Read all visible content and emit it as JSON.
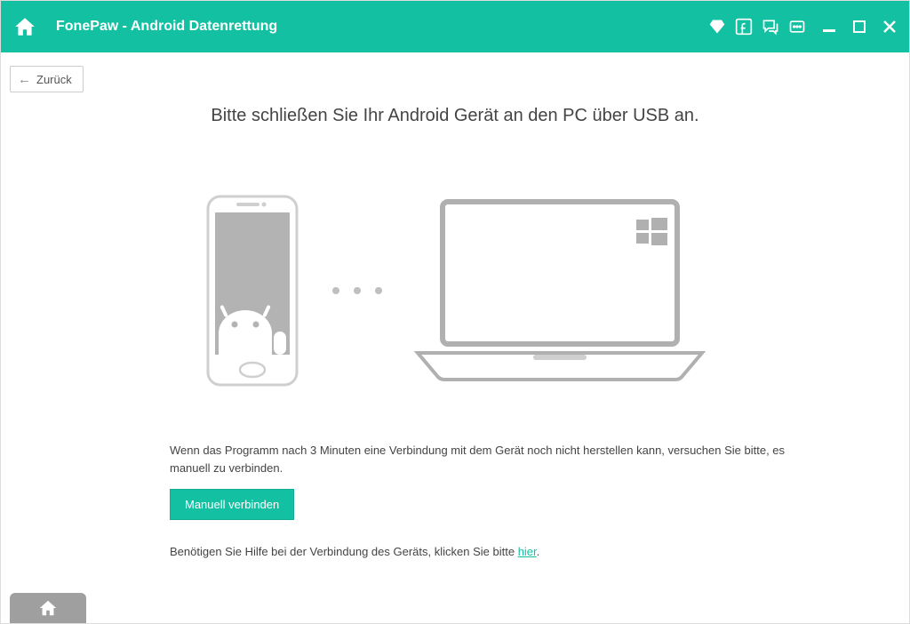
{
  "header": {
    "title": "FonePaw - Android Datenrettung"
  },
  "nav": {
    "back_label": "Zurück"
  },
  "main": {
    "heading": "Bitte schließen Sie Ihr Android Gerät an den PC über USB an.",
    "hint": "Wenn das Programm nach 3 Minuten eine Verbindung mit dem Gerät noch nicht herstellen kann, versuchen Sie bitte, es manuell zu verbinden.",
    "manual_button": "Manuell verbinden",
    "help_prefix": "Benötigen Sie Hilfe bei der Verbindung des Geräts, klicken Sie bitte ",
    "help_link": "hier",
    "help_suffix": "."
  }
}
